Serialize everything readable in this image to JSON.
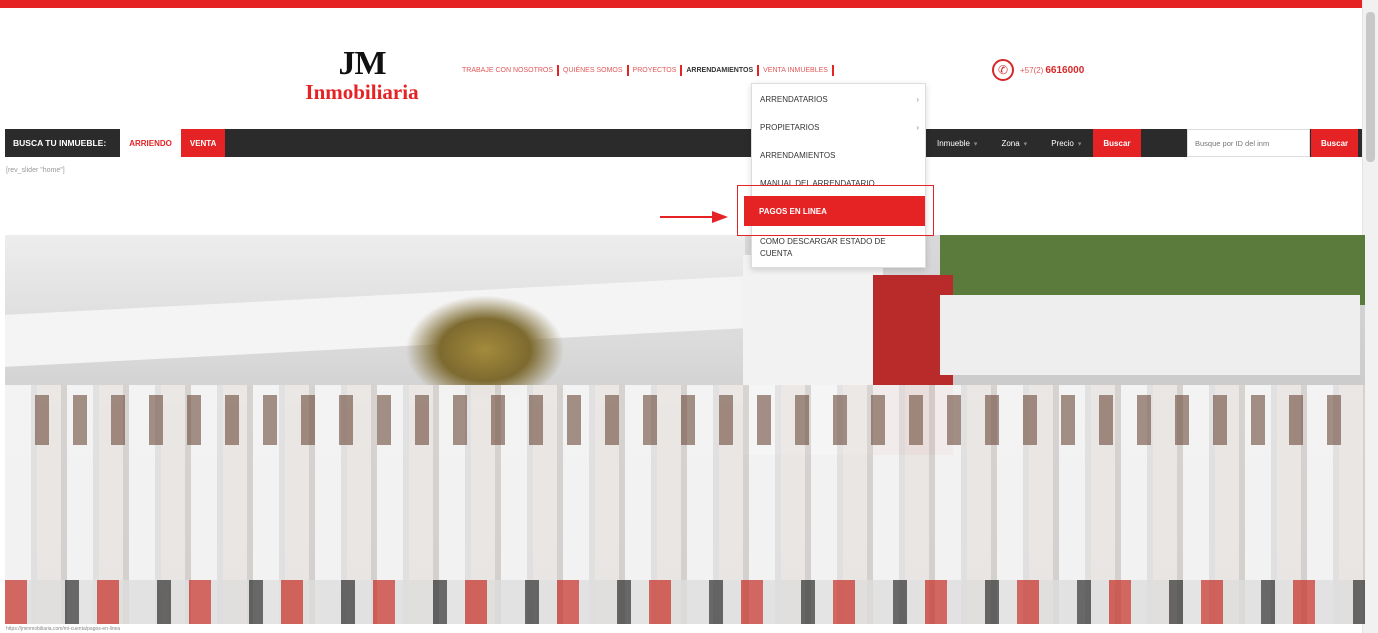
{
  "colors": {
    "brand_red": "#e52325",
    "dark_bar": "#2b2b2b",
    "phone_red": "#d62829",
    "link_red": "#e15a5a",
    "highlight_red": "#e52325"
  },
  "header": {
    "logo_mark": "JM",
    "logo_name": "Inmobiliaria",
    "nav": [
      {
        "label": "TRABAJE CON NOSOTROS"
      },
      {
        "label": "QUIÉNES SOMOS"
      },
      {
        "label": "PROYECTOS"
      },
      {
        "label": "ARRENDAMIENTOS"
      },
      {
        "label": "VENTA INMUEBLES"
      }
    ],
    "phone": {
      "icon": "phone-icon",
      "prefix": "+57(2)",
      "number": "6616000"
    }
  },
  "search_bar": {
    "label": "BUSCA TU INMUEBLE:",
    "tab_rent": "ARRIENDO",
    "tab_sale": "VENTA",
    "filter_type": "Inmueble",
    "filter_zone": "Zona",
    "filter_price": "Precio",
    "search_button": "Buscar",
    "id_placeholder": "Busque por ID del inm",
    "id_button": "Buscar"
  },
  "shortcode_text": "[rev_slider \"home\"]",
  "dropdown": {
    "items": [
      {
        "label": "ARRENDATARIOS",
        "has_submenu": true
      },
      {
        "label": "PROPIETARIOS",
        "has_submenu": true
      },
      {
        "label": "ARRENDAMIENTOS",
        "has_submenu": false
      },
      {
        "label": "MANUAL DEL ARRENDATARIO",
        "has_submenu": false
      },
      {
        "label": "PAGOS EN LINEA",
        "has_submenu": false,
        "highlighted": true
      },
      {
        "label": "COMO DESCARGAR ESTADO DE CUENTA",
        "has_submenu": false
      }
    ]
  },
  "hero_status": "https://jminmobiliaria.com/mi-cuenta/pagos-en-linea"
}
